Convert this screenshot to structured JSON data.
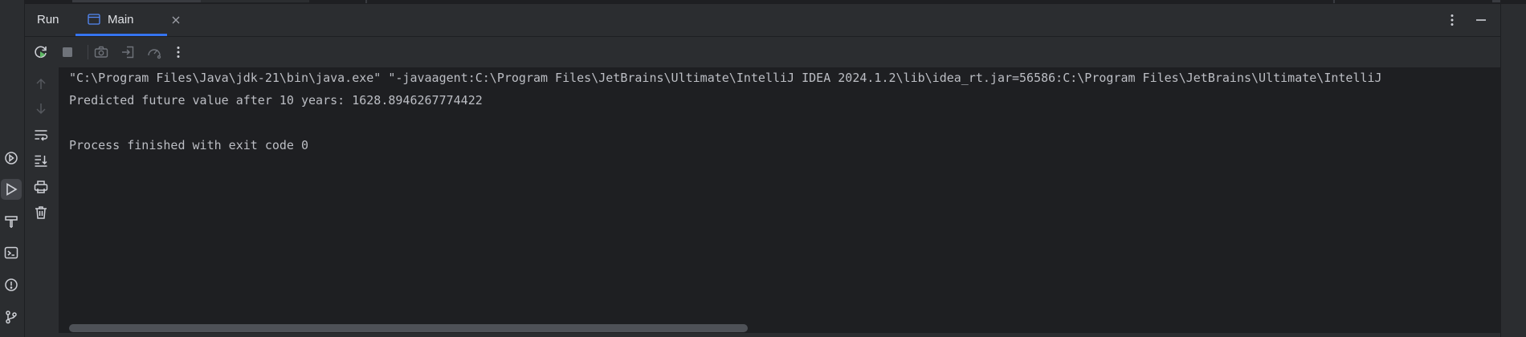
{
  "header": {
    "title": "Run",
    "tab_label": "Main",
    "more_icon": "more-vertical-icon",
    "minimize_icon": "minimize-icon"
  },
  "toolbar": {
    "icons": [
      "rerun-icon",
      "stop-icon",
      "screenshot-icon",
      "restore-layout-icon",
      "coverage-icon",
      "more-vertical-icon"
    ]
  },
  "gutter": {
    "icons": [
      "arrow-up-icon",
      "arrow-down-icon",
      "soft-wrap-icon",
      "scroll-to-end-icon",
      "print-icon",
      "trash-icon"
    ]
  },
  "sidebar": {
    "icons": [
      "services-icon",
      "run-icon",
      "build-icon",
      "terminal-icon",
      "problems-icon",
      "git-icon"
    ]
  },
  "console": {
    "lines": [
      "\"C:\\Program Files\\Java\\jdk-21\\bin\\java.exe\" \"-javaagent:C:\\Program Files\\JetBrains\\Ultimate\\IntelliJ IDEA 2024.1.2\\lib\\idea_rt.jar=56586:C:\\Program Files\\JetBrains\\Ultimate\\IntelliJ",
      "Predicted future value after 10 years: 1628.8946267774422",
      "",
      "Process finished with exit code 0"
    ]
  },
  "colors": {
    "background": "#1e1f22",
    "panel": "#2b2d30",
    "accent": "#3574f0",
    "text": "#bcbec4",
    "rerun_green": "#5fb865"
  }
}
